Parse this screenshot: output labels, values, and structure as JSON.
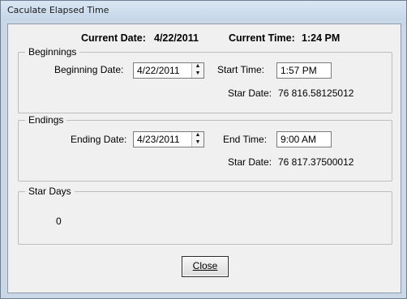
{
  "window": {
    "title": "Caculate Elapsed Time"
  },
  "header": {
    "current_date_label": "Current Date:",
    "current_date": "4/22/2011",
    "current_time_label": "Current Time:",
    "current_time": "1:24 PM"
  },
  "beginnings": {
    "legend": "Beginnings",
    "date_label": "Beginning Date:",
    "date_value": "4/22/2011",
    "time_label": "Start Time:",
    "time_value": "1:57 PM",
    "stardate_label": "Star Date:",
    "stardate_value": "76 816.58125012"
  },
  "endings": {
    "legend": "Endings",
    "date_label": "Ending Date:",
    "date_value": "4/23/2011",
    "time_label": "End Time:",
    "time_value": "9:00 AM",
    "stardate_label": "Star Date:",
    "stardate_value": "76 817.37500012"
  },
  "stardays": {
    "legend": "Star Days",
    "value": "0"
  },
  "buttons": {
    "close": "Close"
  },
  "icons": {
    "spin_up": "spin-up-arrow-icon",
    "spin_down": "spin-down-arrow-icon"
  }
}
